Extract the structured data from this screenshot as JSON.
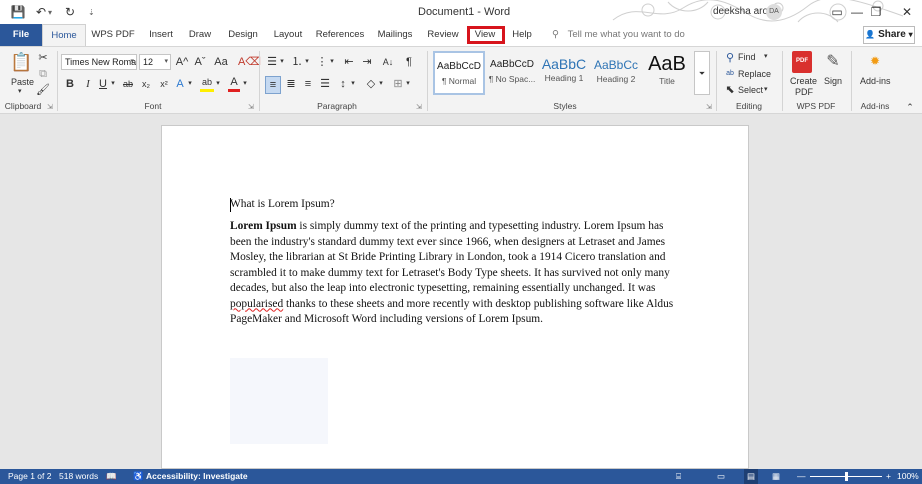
{
  "window": {
    "title": "Document1 - Word",
    "user_name": "deeksha arora",
    "user_initials": "DA",
    "minimize_icon": "—",
    "restore_icon": "❐",
    "close_icon": "✕"
  },
  "quick_access": {
    "save_icon": "💾",
    "undo_icon": "↶",
    "undo_dropdown": "▾",
    "redo_icon": "↻",
    "customize_icon": "⇣"
  },
  "tabs": {
    "file": "File",
    "home": "Home",
    "wps_pdf": "WPS PDF",
    "insert": "Insert",
    "draw": "Draw",
    "design": "Design",
    "layout": "Layout",
    "references": "References",
    "mailings": "Mailings",
    "review": "Review",
    "view": "View",
    "help": "Help"
  },
  "tellme": {
    "icon": "⚲",
    "text": "Tell me what you want to do"
  },
  "share": {
    "label": "Share",
    "icon": "👤",
    "dropdown": "▾"
  },
  "ribbon": {
    "clipboard": {
      "label": "Clipboard",
      "paste": "Paste",
      "paste_dropdown": "▾",
      "cut_icon": "✂",
      "copy_icon": "⧉",
      "format_painter_icon": "🖌"
    },
    "font": {
      "label": "Font",
      "font_name": "Times New Roma",
      "font_size": "12",
      "grow": "A^",
      "shrink": "Aˇ",
      "change_case": "Aa",
      "clear_format": "A⌫",
      "bold": "B",
      "italic": "I",
      "underline": "U",
      "strikethrough": "ab",
      "subscript": "x₂",
      "superscript": "x²",
      "text_effects": "A",
      "highlight": "ab",
      "font_color": "A",
      "dropdown": "▾"
    },
    "paragraph": {
      "label": "Paragraph",
      "bullets_icon": "☰",
      "numbering_icon": "⒈",
      "multilevel_icon": "⋮",
      "decrease_indent_icon": "⇤",
      "increase_indent_icon": "⇥",
      "sort_icon": "A↓",
      "pilcrow": "¶",
      "align_left_icon": "≡",
      "center_icon": "≣",
      "align_right_icon": "≡",
      "justify_icon": "☰",
      "line_spacing_icon": "↕",
      "shading_icon": "◇",
      "borders_icon": "⊞",
      "dropdown": "▾"
    },
    "styles": {
      "label": "Styles",
      "items": [
        {
          "sample": "AaBbCcD",
          "name": "¶ Normal"
        },
        {
          "sample": "AaBbCcD",
          "name": "¶ No Spac..."
        },
        {
          "sample": "AaBbC",
          "name": "Heading 1"
        },
        {
          "sample": "AaBbCc",
          "name": "Heading 2"
        },
        {
          "sample": "AaB",
          "name": "Title"
        }
      ],
      "more": "⏷"
    },
    "editing": {
      "label": "Editing",
      "find": "Find",
      "replace": "Replace",
      "select": "Select",
      "find_icon": "⚲",
      "replace_icon": "ab",
      "select_icon": "⬉",
      "dropdown": "▾"
    },
    "wps_pdf": {
      "label": "WPS PDF",
      "create_pdf_line1": "Create",
      "create_pdf_line2": "PDF",
      "sign": "Sign",
      "pdf_icon": "PDF",
      "sign_icon": "✎"
    },
    "addins": {
      "label": "Add-ins",
      "button": "Add-ins",
      "icon": "✹"
    },
    "collapse_icon": "⌃"
  },
  "document": {
    "heading": "What is Lorem Ipsum?",
    "body_bold": "Lorem Ipsum",
    "body_line1": " is simply dummy text of the printing and typesetting industry. Lorem Ipsum has",
    "body_line2": "been the industry's standard dummy text ever since 1966, when designers at Letraset and James",
    "body_line3": "Mosley, the librarian at St Bride Printing Library in London, took a 1914 Cicero translation and",
    "body_line4": "scrambled it to make dummy text for Letraset's Body Type sheets. It has survived not only many",
    "body_line5": "decades, but also the leap into electronic typesetting, remaining essentially unchanged. It was",
    "body_misspelled": "popularised",
    "body_line6": " thanks to these sheets and more recently with desktop publishing software like Aldus",
    "body_line7": "PageMaker and Microsoft Word including versions of Lorem Ipsum."
  },
  "status": {
    "page": "Page 1 of 2",
    "words": "518 words",
    "proofing_icon": "📖",
    "accessibility_icon": "♿",
    "accessibility": "Accessibility: Investigate",
    "focus_icon": "⌸",
    "read_mode_icon": "▭",
    "print_layout_icon": "▤",
    "web_layout_icon": "▦",
    "zoom_out": "—",
    "zoom_in": "+",
    "zoom": "100%",
    "zoom_level": 0.5
  }
}
